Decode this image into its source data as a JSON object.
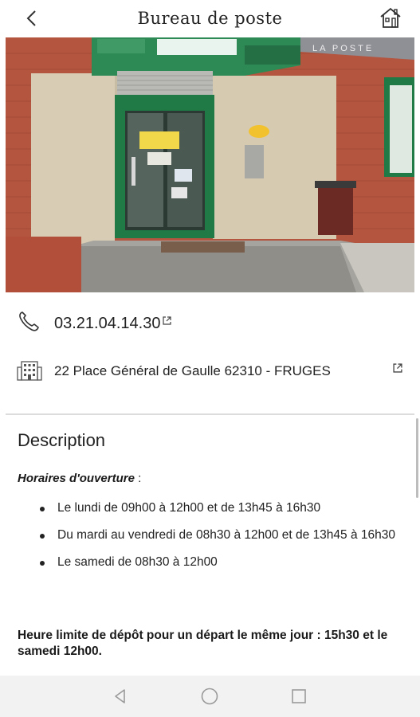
{
  "header": {
    "title": "Bureau de poste",
    "back_icon": "chevron-left-icon",
    "home_icon": "home-icon"
  },
  "photo": {
    "sign_text": "LA POSTE",
    "alt": "post-office-entrance-photo"
  },
  "contact": {
    "phone": "03.21.04.14.30",
    "phone_icon": "phone-icon",
    "address": "22 Place Général de Gaulle 62310 - FRUGES",
    "address_icon": "building-icon",
    "external_link_icon": "external-link-icon"
  },
  "description": {
    "title": "Description",
    "hours_label": "Horaires d'ouverture",
    "hours_colon": " :",
    "hours": [
      "Le lundi de 09h00 à 12h00 et de 13h45 à 16h30",
      "Du mardi au vendredi de 08h30 à 12h00 et de 13h45 à 16h30",
      "Le samedi de 08h30 à 12h00"
    ],
    "deadline": "Heure limite de dépôt pour un départ le même jour : 15h30 et le samedi 12h00."
  },
  "colors": {
    "text": "#222222",
    "divider": "#dcdcdc",
    "navbar": "#f2f2f2",
    "door_green": "#1f7a45"
  }
}
